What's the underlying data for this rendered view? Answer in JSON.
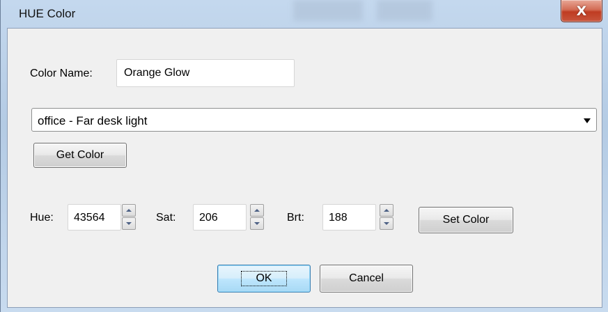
{
  "window": {
    "title": "HUE Color",
    "close_glyph": "X"
  },
  "form": {
    "color_name_label": "Color Name:",
    "color_name_value": "Orange Glow",
    "light_select_value": "office - Far desk light",
    "get_color_label": "Get Color",
    "hue_label": "Hue:",
    "hue_value": "43564",
    "sat_label": "Sat:",
    "sat_value": "206",
    "brt_label": "Brt:",
    "brt_value": "188",
    "set_color_label": "Set Color"
  },
  "footer": {
    "ok_label": "OK",
    "cancel_label": "Cancel"
  },
  "icons": {
    "close": "close-icon",
    "dropdown": "chevron-down-icon",
    "spin_up": "arrow-up-icon",
    "spin_down": "arrow-down-icon"
  },
  "colors": {
    "accent": "#3c7fb1",
    "close_button": "#c8553c",
    "dialog_bg": "#f0f0f0"
  }
}
